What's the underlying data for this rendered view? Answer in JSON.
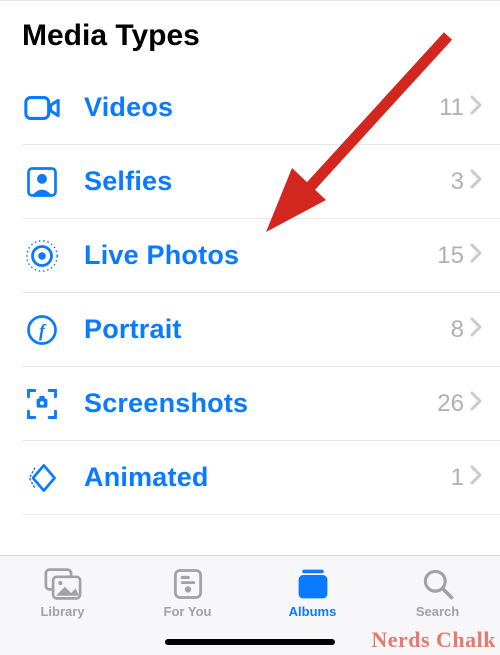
{
  "header": {
    "title": "Media Types"
  },
  "mediaTypes": [
    {
      "icon": "videos-icon",
      "label": "Videos",
      "count": "11"
    },
    {
      "icon": "selfies-icon",
      "label": "Selfies",
      "count": "3"
    },
    {
      "icon": "live-photos-icon",
      "label": "Live Photos",
      "count": "15"
    },
    {
      "icon": "portrait-icon",
      "label": "Portrait",
      "count": "8"
    },
    {
      "icon": "screenshots-icon",
      "label": "Screenshots",
      "count": "26"
    },
    {
      "icon": "animated-icon",
      "label": "Animated",
      "count": "1"
    }
  ],
  "tabs": [
    {
      "icon": "library-tab-icon",
      "label": "Library",
      "active": false
    },
    {
      "icon": "foryou-tab-icon",
      "label": "For You",
      "active": false
    },
    {
      "icon": "albums-tab-icon",
      "label": "Albums",
      "active": true
    },
    {
      "icon": "search-tab-icon",
      "label": "Search",
      "active": false
    }
  ],
  "watermark": "Nerds Chalk"
}
